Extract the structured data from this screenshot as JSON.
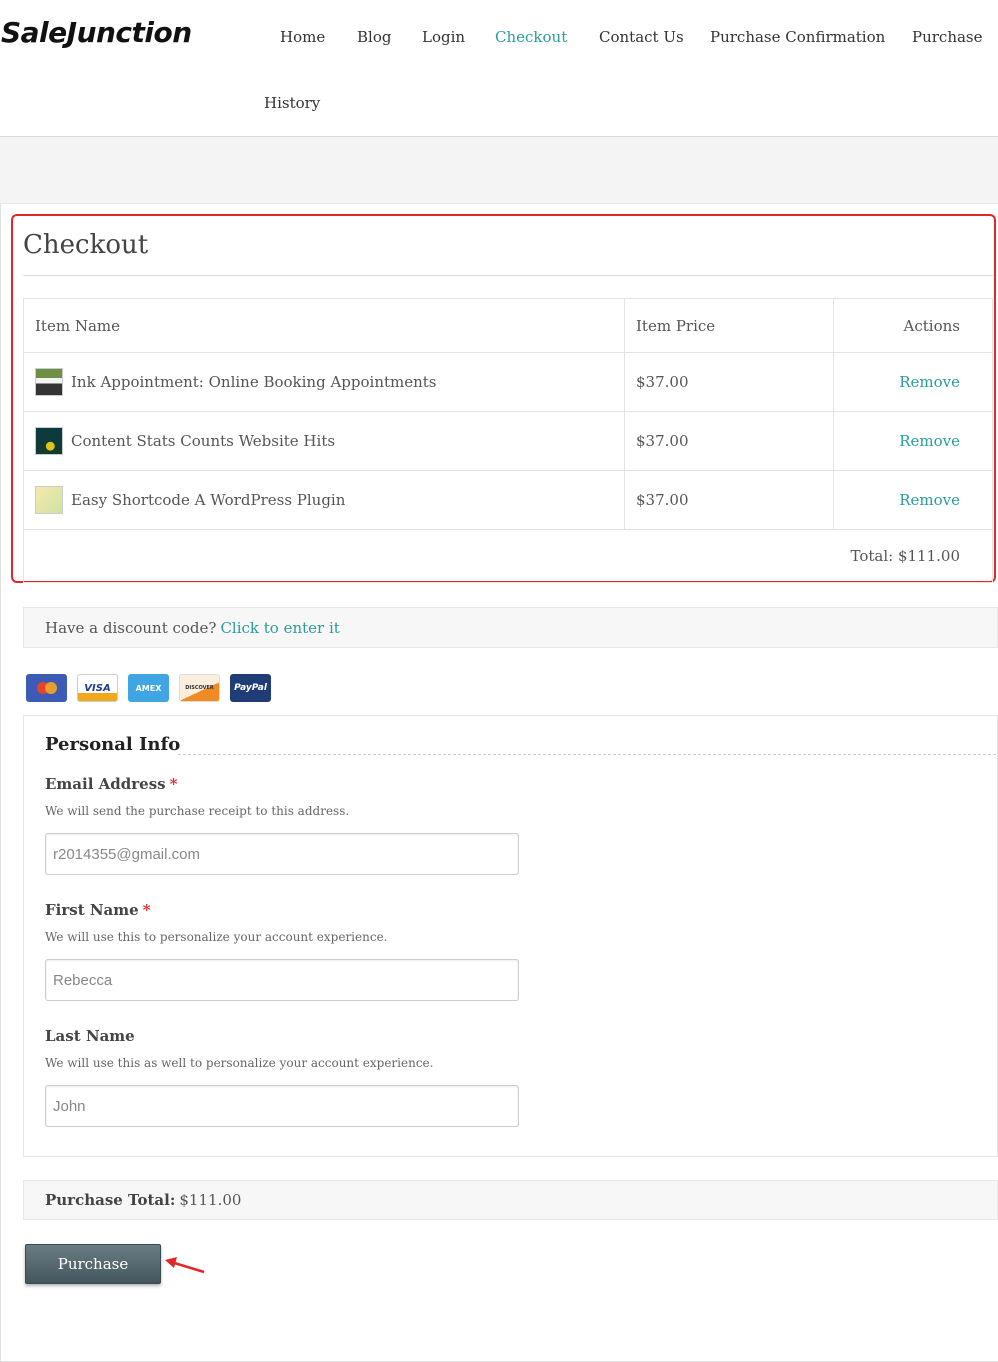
{
  "header": {
    "logo": "SaleJunction",
    "nav": [
      {
        "label": "Home"
      },
      {
        "label": "Blog"
      },
      {
        "label": "Login"
      },
      {
        "label": "Checkout",
        "active": true
      },
      {
        "label": "Contact Us"
      },
      {
        "label": "Purchase Confirmation"
      },
      {
        "label": "Purchase"
      },
      {
        "label": "History"
      }
    ]
  },
  "checkout": {
    "title": "Checkout",
    "columns": {
      "name": "Item Name",
      "price": "Item Price",
      "actions": "Actions"
    },
    "items": [
      {
        "name": "Ink Appointment: Online Booking Appointments",
        "price": "$37.00",
        "action": "Remove"
      },
      {
        "name": "Content Stats Counts Website Hits",
        "price": "$37.00",
        "action": "Remove"
      },
      {
        "name": "Easy Shortcode A WordPress Plugin",
        "price": "$37.00",
        "action": "Remove"
      }
    ],
    "total": "Total: $111.00"
  },
  "discount": {
    "prompt": "Have a discount code?",
    "link": "Click to enter it"
  },
  "payment_icons": [
    {
      "name": "mastercard-icon",
      "label": ""
    },
    {
      "name": "visa-icon",
      "label": "VISA"
    },
    {
      "name": "amex-icon",
      "label": "AMEX"
    },
    {
      "name": "discover-icon",
      "label": "DISCOVER"
    },
    {
      "name": "paypal-icon",
      "label": "PayPal"
    }
  ],
  "personal_info": {
    "legend": "Personal Info",
    "email": {
      "label": "Email Address",
      "required": "*",
      "desc": "We will send the purchase receipt to this address.",
      "value": "r2014355@gmail.com"
    },
    "first_name": {
      "label": "First Name",
      "required": "*",
      "desc": "We will use this to personalize your account experience.",
      "value": "Rebecca"
    },
    "last_name": {
      "label": "Last Name",
      "desc": "We will use this as well to personalize your account experience.",
      "value": "John"
    }
  },
  "purchase": {
    "total_label": "Purchase Total:",
    "total_value": "$111.00",
    "button": "Purchase"
  },
  "colors": {
    "accent": "#2a9d9b",
    "highlight": "#e2262a",
    "button": "#55666e"
  }
}
